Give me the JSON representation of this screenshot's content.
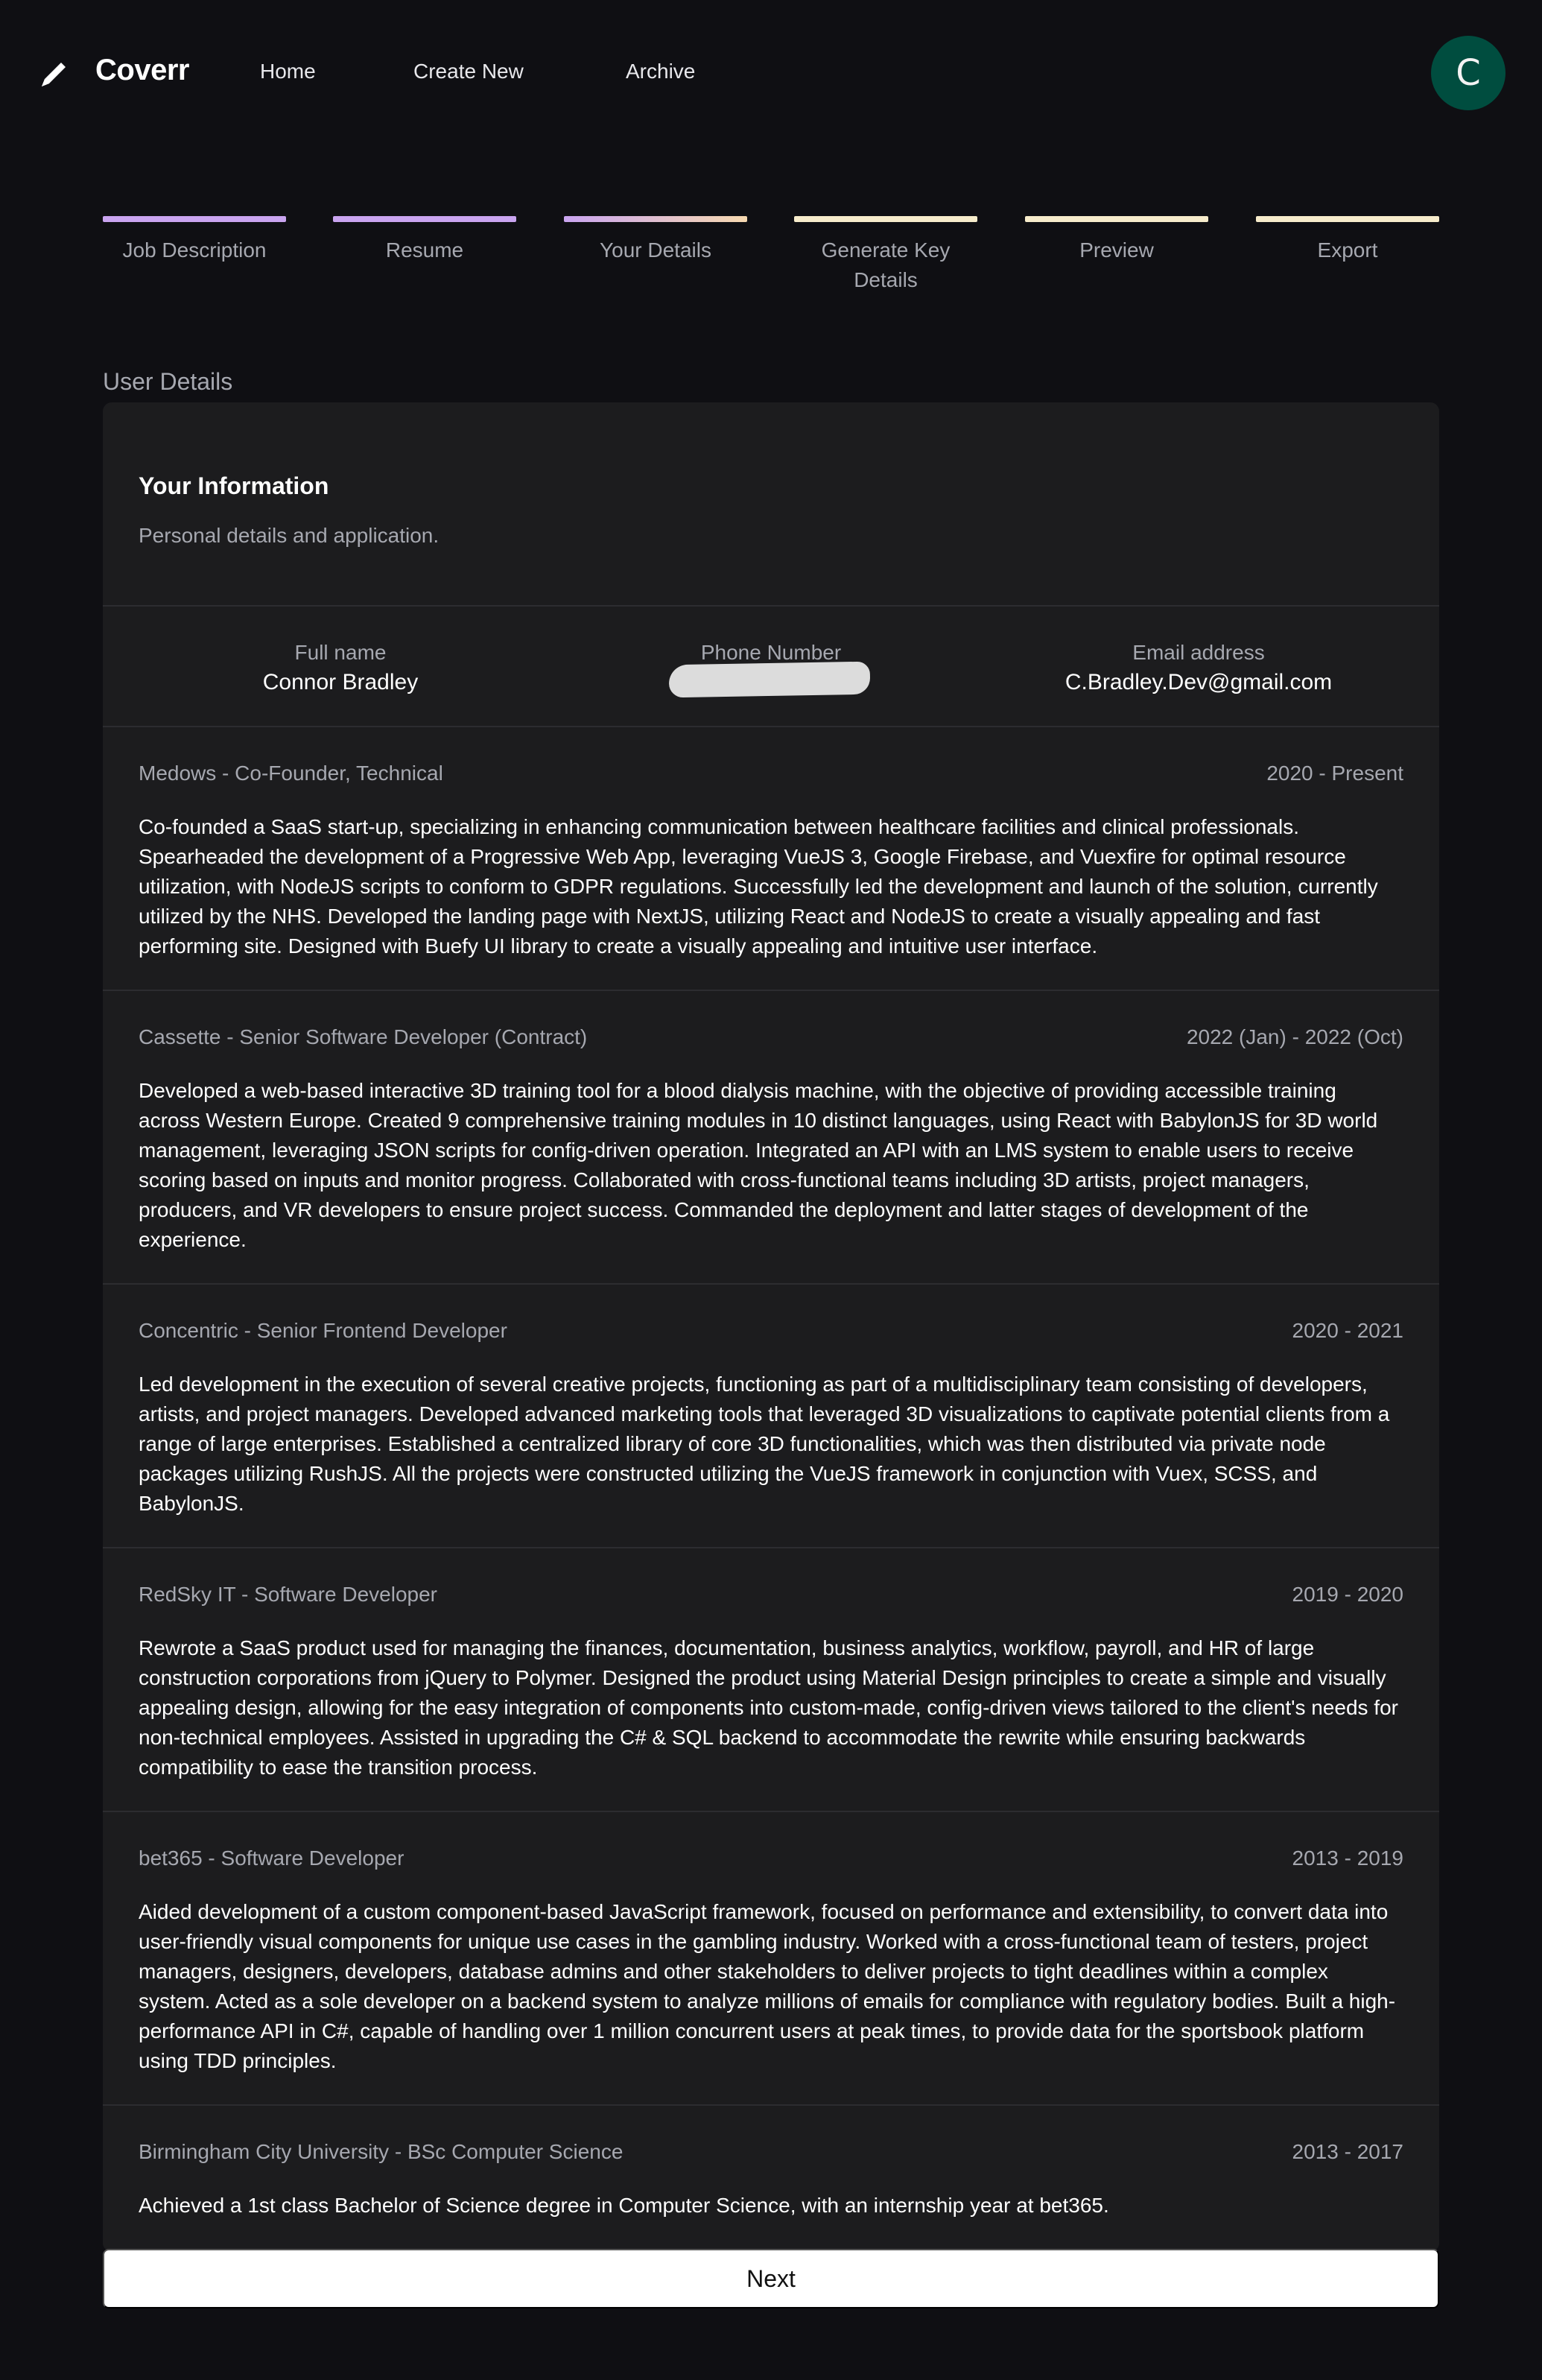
{
  "nav": {
    "brand": "Coverr",
    "links": [
      "Home",
      "Create New",
      "Archive"
    ],
    "avatar_initial": "C"
  },
  "steps": [
    {
      "label": "Job Description",
      "color": "#c9a4f0"
    },
    {
      "label": "Resume",
      "color": "#c9a4f0"
    },
    {
      "label": "Your Details",
      "color": "#d7b3e6"
    },
    {
      "label": "Generate Key Details",
      "color": "#f7eccb"
    },
    {
      "label": "Preview",
      "color": "#f7eccb"
    },
    {
      "label": "Export",
      "color": "#f7eccb"
    }
  ],
  "section_title": "User Details",
  "card": {
    "title": "Your Information",
    "subtitle": "Personal details and application.",
    "fields": {
      "full_name_label": "Full name",
      "full_name": "Connor Bradley",
      "phone_label": "Phone Number",
      "email_label": "Email address",
      "email": "C.Bradley.Dev@gmail.com"
    },
    "experiences": [
      {
        "title": "Medows - Co-Founder, Technical",
        "period": "2020 - Present",
        "description": "Co-founded a SaaS start-up, specializing in enhancing communication between healthcare facilities and clinical professionals. Spearheaded the development of a Progressive Web App, leveraging VueJS 3, Google Firebase, and Vuexfire for optimal resource utilization, with NodeJS scripts to conform to GDPR regulations. Successfully led the development and launch of the solution, currently utilized by the NHS. Developed the landing page with NextJS, utilizing React and NodeJS to create a visually appealing and fast performing site. Designed with Buefy UI library to create a visually appealing and intuitive user interface."
      },
      {
        "title": "Cassette - Senior Software Developer (Contract)",
        "period": "2022 (Jan) - 2022 (Oct)",
        "description": "Developed a web-based interactive 3D training tool for a blood dialysis machine, with the objective of providing accessible training across Western Europe. Created 9 comprehensive training modules in 10 distinct languages, using React with BabylonJS for 3D world management, leveraging JSON scripts for config-driven operation. Integrated an API with an LMS system to enable users to receive scoring based on inputs and monitor progress. Collaborated with cross-functional teams including 3D artists, project managers, producers, and VR developers to ensure project success. Commanded the deployment and latter stages of development of the experience."
      },
      {
        "title": "Concentric - Senior Frontend Developer",
        "period": "2020 - 2021",
        "description": "Led development in the execution of several creative projects, functioning as part of a multidisciplinary team consisting of developers, artists, and project managers. Developed advanced marketing tools that leveraged 3D visualizations to captivate potential clients from a range of large enterprises. Established a centralized library of core 3D functionalities, which was then distributed via private node packages utilizing RushJS. All the projects were constructed utilizing the VueJS framework in conjunction with Vuex, SCSS, and BabylonJS."
      },
      {
        "title": "RedSky IT - Software Developer",
        "period": "2019 - 2020",
        "description": "Rewrote a SaaS product used for managing the finances, documentation, business analytics, workflow, payroll, and HR of large construction corporations from jQuery to Polymer. Designed the product using Material Design principles to create a simple and visually appealing design, allowing for the easy integration of components into custom-made, config-driven views tailored to the client's needs for non-technical employees. Assisted in upgrading the C# & SQL backend to accommodate the rewrite while ensuring backwards compatibility to ease the transition process."
      },
      {
        "title": "bet365 - Software Developer",
        "period": "2013 - 2019",
        "description": "Aided development of a custom component-based JavaScript framework, focused on performance and extensibility, to convert data into user-friendly visual components for unique use cases in the gambling industry. Worked with a cross-functional team of testers, project managers, designers, developers, database admins and other stakeholders to deliver projects to tight deadlines within a complex system. Acted as a sole developer on a backend system to analyze millions of emails for compliance with regulatory bodies. Built a high-performance API in C#, capable of handling over 1 million concurrent users at peak times, to provide data for the sportsbook platform using TDD principles."
      },
      {
        "title": "Birmingham City University - BSc Computer Science",
        "period": "2013 - 2017",
        "description": "Achieved a 1st class Bachelor of Science degree in Computer Science, with an internship year at bet365."
      }
    ]
  },
  "next_label": "Next"
}
